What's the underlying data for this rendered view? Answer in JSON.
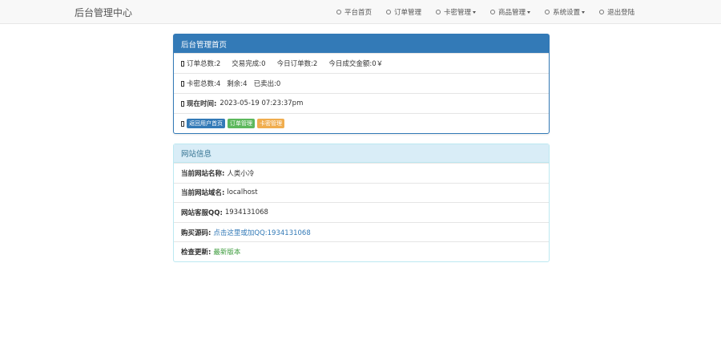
{
  "navbar": {
    "brand": "后台管理中心",
    "items": [
      {
        "label": "平台首页",
        "dropdown": false
      },
      {
        "label": "订单管理",
        "dropdown": false
      },
      {
        "label": "卡密管理",
        "dropdown": true
      },
      {
        "label": "商品管理",
        "dropdown": true
      },
      {
        "label": "系统设置",
        "dropdown": true
      },
      {
        "label": "退出登陆",
        "dropdown": false
      }
    ]
  },
  "dashboard": {
    "title": "后台管理首页",
    "orders_total": "订单总数:2",
    "trade_done": "交易完成:0",
    "today_orders": "今日订单数:2",
    "today_amount": "今日成交金额:0￥",
    "cards_total": "卡密总数:4",
    "cards_left": "剩余:4",
    "cards_sold": "已卖出:0",
    "time_label": "现在时间:",
    "time_value": "2023-05-19 07:23:37pm",
    "btn_home": "返回用户首页",
    "btn_orders": "订单管理",
    "btn_cards": "卡密管理"
  },
  "site_info": {
    "title": "网站信息",
    "name_label": "当前网站名称:",
    "name_value": "人类小冷",
    "domain_label": "当前网站域名:",
    "domain_value": "localhost",
    "qq_label": "网站客服QQ:",
    "qq_value": "1934131068",
    "buy_label": "购买源码:",
    "buy_value": "点击这里或加QQ:1934131068",
    "update_label": "检查更新:",
    "update_value": "最新版本"
  },
  "colors": {
    "primary": "#337ab7",
    "success": "#5cb85c",
    "warning": "#f0ad4e",
    "info_bg": "#d9edf7"
  }
}
